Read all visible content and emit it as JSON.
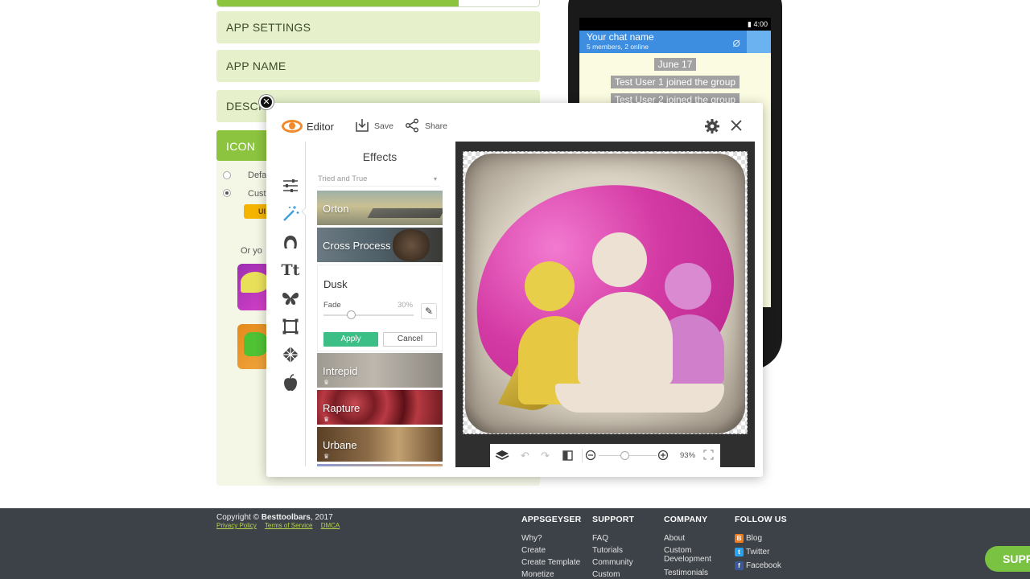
{
  "builder": {
    "progress_percent": 75,
    "sections": [
      "APP SETTINGS",
      "APP NAME",
      "DESCRI",
      "ICON"
    ],
    "radio_default": "Defa",
    "radio_custom": "Cust",
    "upload_label": "UI",
    "or_text": "Or yo"
  },
  "phone": {
    "time": "4:00",
    "chat_name": "Your chat name",
    "chat_members": "5 members, 2 online",
    "messages": [
      "June 17",
      "Test User 1 joined the group",
      "Test User 2 joined the group"
    ]
  },
  "editor": {
    "title": "Editor",
    "save_label": "Save",
    "share_label": "Share",
    "effects_title": "Effects",
    "dropdown_value": "Tried and True",
    "effects": [
      "Orton",
      "Cross Process",
      "Dusk",
      "Intrepid",
      "Rapture",
      "Urbane"
    ],
    "dusk": {
      "fade_label": "Fade",
      "fade_value": "30%",
      "fade_percent": 30,
      "apply_label": "Apply",
      "cancel_label": "Cancel"
    },
    "zoom": "93%",
    "zoom_percent": 45
  },
  "footer": {
    "copyright_prefix": "Copyright ©",
    "copyright_brand": "Besttoolbars",
    "copyright_year": ", 2017",
    "links": [
      "Privacy Policy",
      "Terms of Service",
      "DMCA"
    ],
    "columns": [
      {
        "heading": "APPSGEYSER",
        "items": [
          "Why?",
          "Create",
          "Create Template",
          "Monetize"
        ]
      },
      {
        "heading": "SUPPORT",
        "items": [
          "FAQ",
          "Tutorials",
          "Community",
          "Custom"
        ]
      },
      {
        "heading": "COMPANY",
        "items": [
          "About",
          "Custom",
          "Development",
          "Testimonials"
        ]
      },
      {
        "heading": "FOLLOW US",
        "items": [
          "Blog",
          "Twitter",
          "Facebook"
        ]
      }
    ],
    "support_button": "SUPP"
  },
  "colors": {
    "accent_green": "#8cc43f",
    "apply_green": "#3bbf86",
    "chat_blue": "#3d8ee0",
    "footer_bg": "#3d4248"
  }
}
